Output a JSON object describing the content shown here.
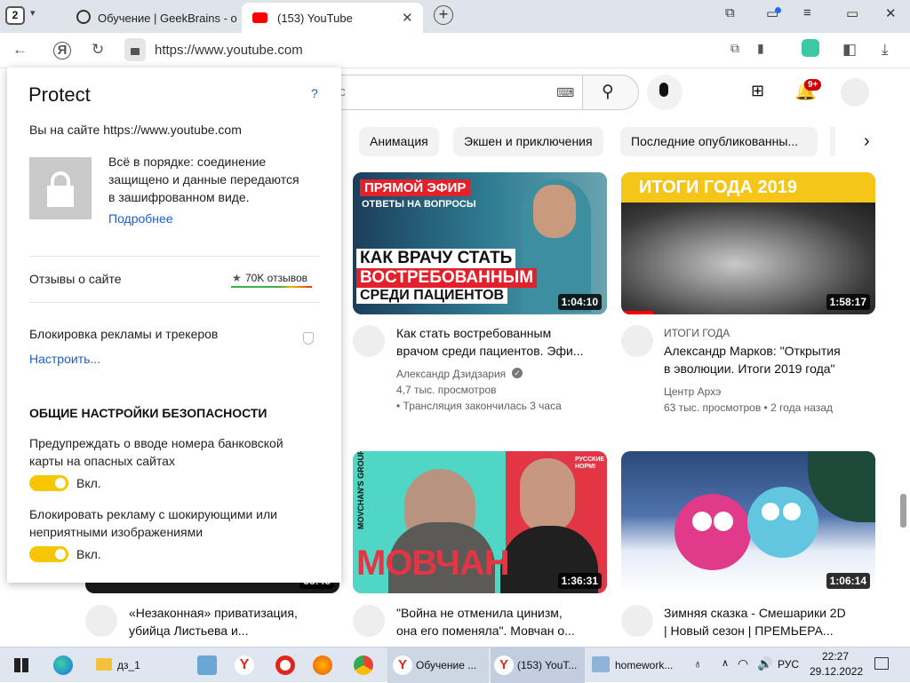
{
  "browser": {
    "tab_count": "2",
    "tabs": [
      {
        "title": "Обучение | GeekBrains - о",
        "icon": "geekbrains-icon"
      },
      {
        "title": "(153) YouTube",
        "icon": "youtube-icon"
      }
    ],
    "url": "https://www.youtube.com"
  },
  "youtube": {
    "search_placeholder": "ос",
    "notification_badge": "9+",
    "chips": [
      "Анимация",
      "Экшен и приключения",
      "Последние опубликованны..."
    ],
    "videos": [
      {
        "thumb_line1": "ПРЯМОЙ ЭФИР",
        "thumb_line2": "ОТВЕТЫ НА ВОПРОСЫ",
        "thumb_line3": "КАК ВРАЧУ СТАТЬ",
        "thumb_line4": "ВОСТРЕБОВАННЫМ",
        "thumb_line5": "СРЕДИ ПАЦИЕНТОВ",
        "duration": "1:04:10",
        "title1": "Как стать востребованным",
        "title2": "врачом среди пациентов. Эфи...",
        "channel": "Александр Дзидзария",
        "views": "4,7 тыс. просмотров",
        "time": "• Трансляция закончилась 3 часа"
      },
      {
        "thumb_line1": "ИТОГИ ГОДА 2019",
        "duration": "1:58:17",
        "label": "ИТОГИ ГОДА",
        "title1": "Александр Марков: \"Открытия",
        "title2": "в эволюции. Итоги 2019 года\"",
        "channel": "Центр Архэ",
        "views": "63 тыс. просмотров • 2 года назад"
      },
      {
        "duration": "33:45",
        "title1": "«Незаконная» приватизация,",
        "title2": "убийца Листьева и..."
      },
      {
        "thumb_side": "MOVCHAN'S GROUP",
        "thumb_big": "МОВЧАН",
        "thumb_corner": "РУССКИЕ НОРМ!",
        "duration": "1:36:31",
        "title1": "\"Война не отменила цинизм,",
        "title2": "она его поменяла\". Мовчан о..."
      },
      {
        "duration": "1:06:14",
        "title1": "Зимняя сказка - Смешарики 2D",
        "title2": "| Новый сезон | ПРЕМЬЕРА..."
      }
    ]
  },
  "protect": {
    "title": "Protect",
    "help": "?",
    "site_line": "Вы на сайте https://www.youtube.com",
    "status_line1": "Всё в порядке: соединение",
    "status_line2": "защищено и данные передаются",
    "status_line3": "в зашифрованном виде.",
    "more_link": "Подробнее",
    "reviews_label": "Отзывы о сайте",
    "reviews_count": "70K отзывов",
    "adblock_label": "Блокировка рекламы и трекеров",
    "configure_link": "Настроить...",
    "section_title": "ОБЩИЕ НАСТРОЙКИ БЕЗОПАСНОСТИ",
    "setting1_line1": "Предупреждать о вводе номера банковской",
    "setting1_line2": "карты на опасных сайтах",
    "setting1_state": "Вкл.",
    "setting2_line1": "Блокировать рекламу с шокирующими или",
    "setting2_line2": "неприятными изображениями",
    "setting2_state": "Вкл."
  },
  "taskbar": {
    "folder_label": "дз_1",
    "yandex1_label": "Обучение ...",
    "yandex2_label": "(153) YouT...",
    "word_label": "homework...",
    "lang": "РУС",
    "time": "22:27",
    "date": "29.12.2022"
  }
}
